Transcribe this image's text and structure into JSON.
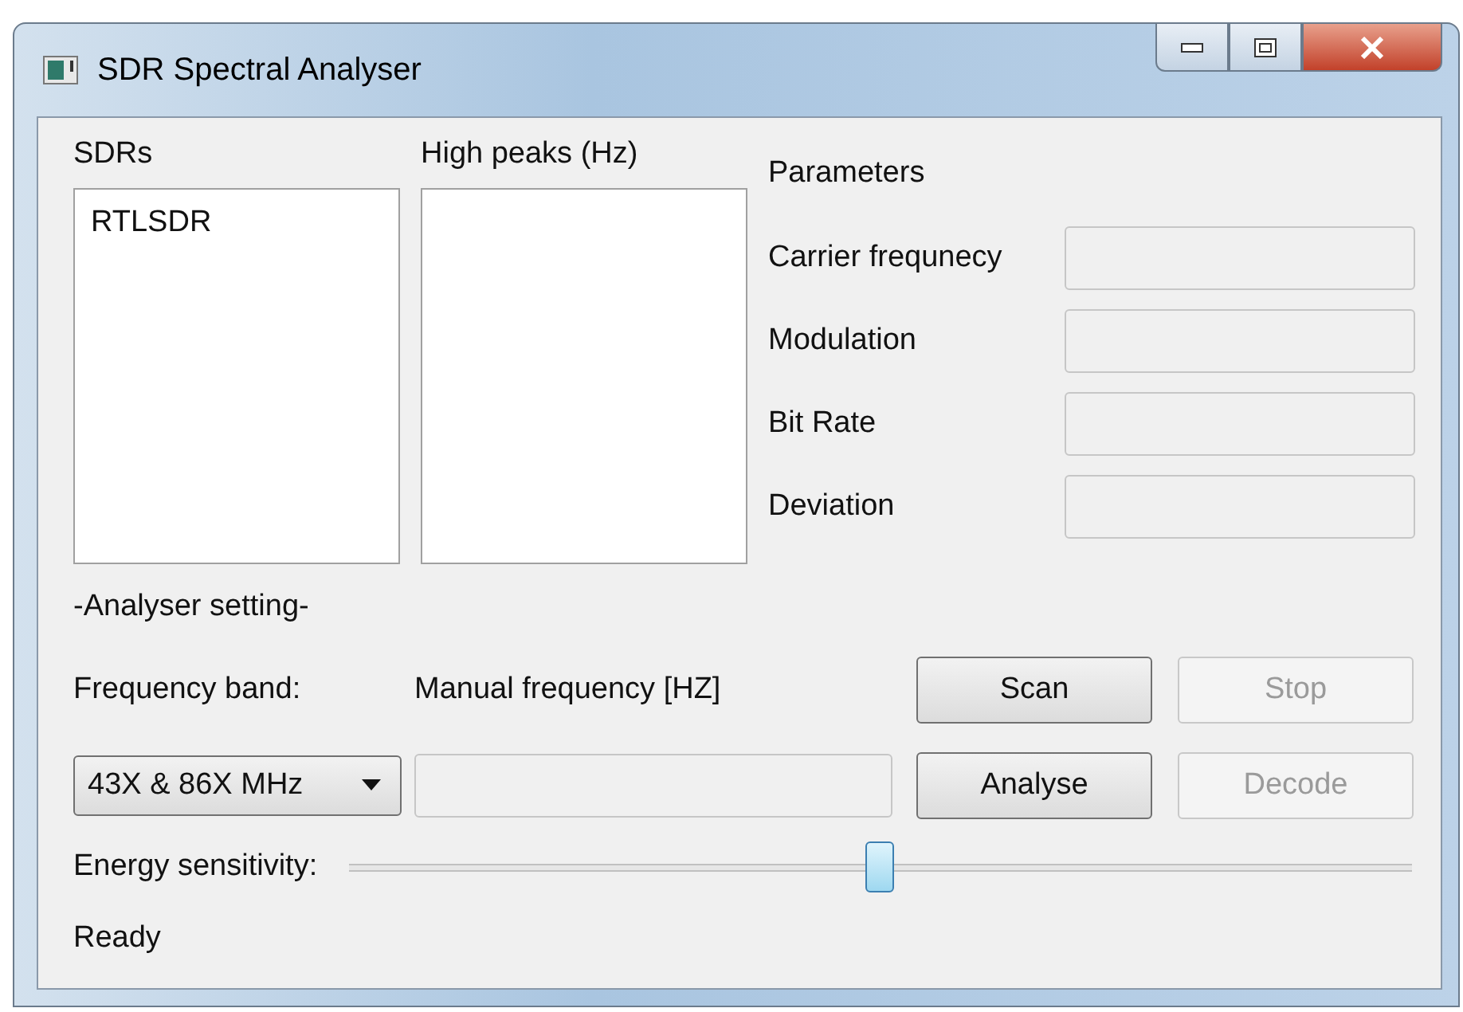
{
  "window": {
    "title": "SDR Spectral Analyser"
  },
  "sdrs": {
    "label": "SDRs",
    "items": [
      {
        "text": "RTLSDR",
        "selected": false
      }
    ]
  },
  "high_peaks": {
    "label": "High peaks (Hz)"
  },
  "parameters": {
    "label": "Parameters",
    "fields": [
      {
        "label": "Carrier frequnecy"
      },
      {
        "label": "Modulation"
      },
      {
        "label": "Bit Rate"
      },
      {
        "label": "Deviation"
      }
    ]
  },
  "analyser_setting": {
    "label": "-Analyser setting-",
    "frequency_band_label": "Frequency band:",
    "manual_frequency_label": "Manual frequency [HZ]",
    "frequency_band": {
      "value": "43X & 86X MHz"
    }
  },
  "buttons": [
    {
      "label": "Scan",
      "disabled": false
    },
    {
      "label": "Stop",
      "disabled": true
    },
    {
      "label": "Analyse",
      "disabled": false
    },
    {
      "label": "Decode",
      "disabled": true
    }
  ],
  "energy_sensitivity": {
    "label": "Energy sensitivity:",
    "level": 0.5
  },
  "status": "Ready"
}
